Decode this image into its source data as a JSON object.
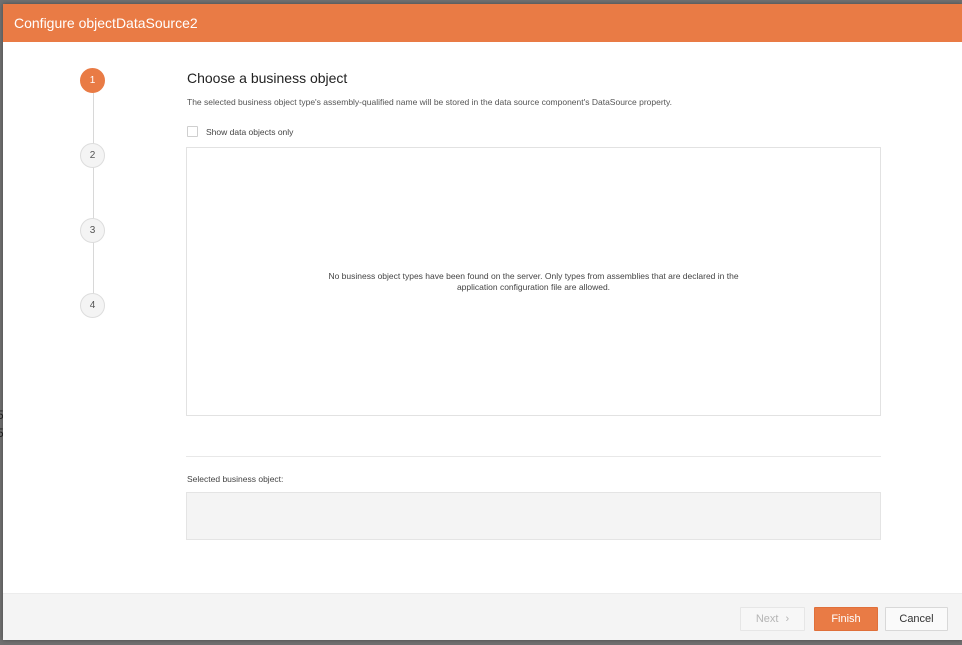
{
  "dialog": {
    "title": "Configure objectDataSource2"
  },
  "steps": [
    {
      "number": "1",
      "active": true
    },
    {
      "number": "2",
      "active": false
    },
    {
      "number": "3",
      "active": false
    },
    {
      "number": "4",
      "active": false
    }
  ],
  "page": {
    "heading": "Choose a business object",
    "description": "The selected business object type's assembly-qualified name will be stored in the data source component's DataSource property.",
    "checkbox_label": "Show data objects only",
    "checkbox_checked": false,
    "empty_message": "No business object types have been found on the server. Only types from assemblies that are declared in the application configuration file are allowed.",
    "selected_label": "Selected business object:",
    "selected_value": ""
  },
  "footer": {
    "next_label": "Next",
    "next_icon": "chevron-right-icon",
    "finish_label": "Finish",
    "cancel_label": "Cancel"
  },
  "colors": {
    "accent": "#e97b45",
    "footer_bg": "#f4f4f4"
  }
}
